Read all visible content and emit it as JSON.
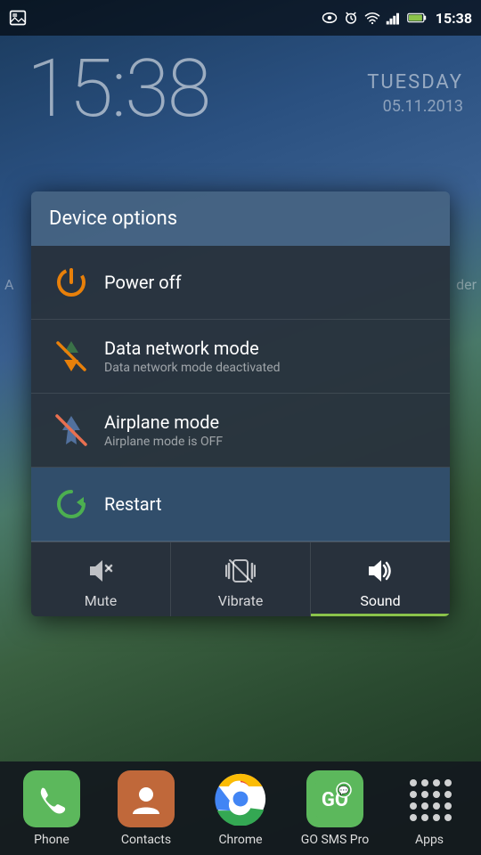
{
  "statusBar": {
    "time": "15:38",
    "icons": [
      "gallery",
      "eye",
      "alarm",
      "wifi",
      "signal",
      "battery"
    ]
  },
  "wallpaper": {
    "time": "15:38",
    "day": "TUESDAY",
    "date": "05.11.2013"
  },
  "dialog": {
    "title": "Device options",
    "items": [
      {
        "id": "power-off",
        "label": "Power off",
        "subtitle": ""
      },
      {
        "id": "data-network",
        "label": "Data network mode",
        "subtitle": "Data network mode deactivated"
      },
      {
        "id": "airplane",
        "label": "Airplane mode",
        "subtitle": "Airplane mode is OFF"
      },
      {
        "id": "restart",
        "label": "Restart",
        "subtitle": ""
      }
    ],
    "soundOptions": [
      {
        "id": "mute",
        "label": "Mute",
        "active": false
      },
      {
        "id": "vibrate",
        "label": "Vibrate",
        "active": false
      },
      {
        "id": "sound",
        "label": "Sound",
        "active": true
      }
    ]
  },
  "dock": {
    "items": [
      {
        "id": "phone",
        "label": "Phone"
      },
      {
        "id": "contacts",
        "label": "Contacts"
      },
      {
        "id": "chrome",
        "label": "Chrome"
      },
      {
        "id": "gosms",
        "label": "GO SMS Pro"
      },
      {
        "id": "apps",
        "label": "Apps"
      }
    ]
  },
  "sideTexts": {
    "left": "A",
    "right": "der"
  }
}
